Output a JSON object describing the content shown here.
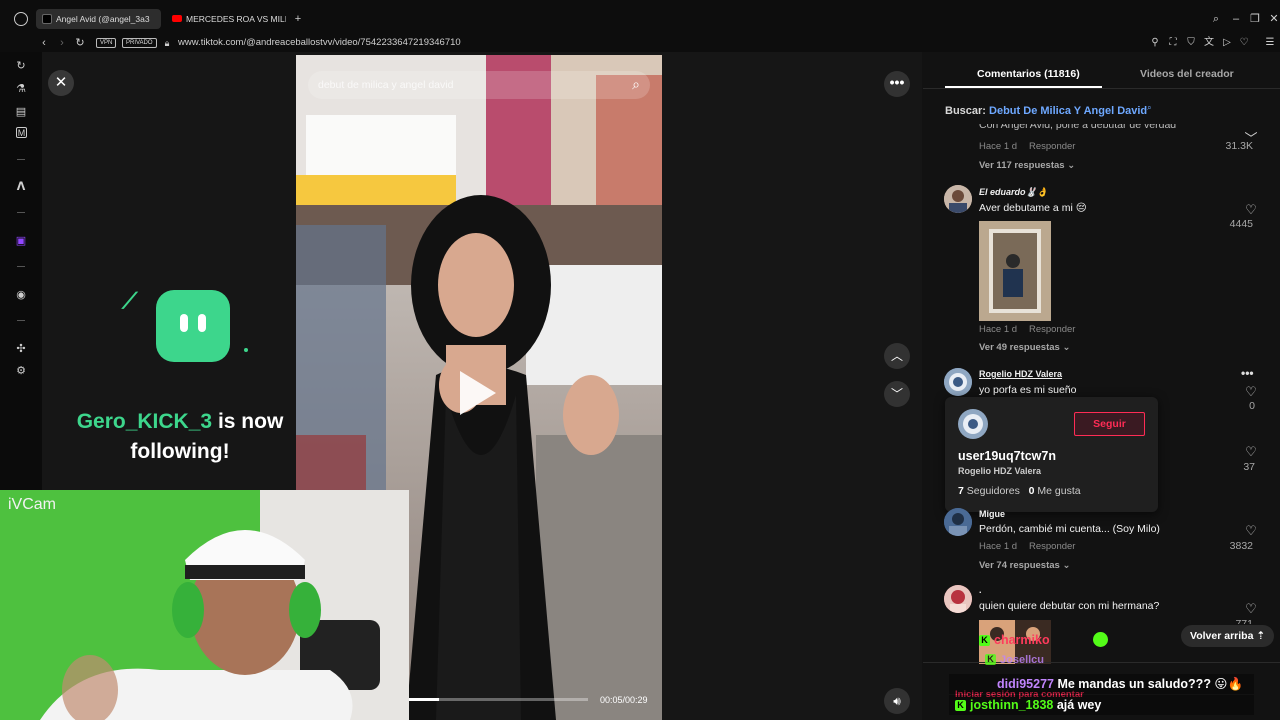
{
  "browser": {
    "tabs": [
      {
        "label": "Angel Avid (@angel_3a3",
        "active": true
      },
      {
        "label": "MERCEDES ROA VS MILIC",
        "active": false
      }
    ],
    "vpn_label": "VPN",
    "private_label": "PRIVADO",
    "url": "www.tiktok.com/@andreaceballostvv/video/7542233647219346710"
  },
  "player": {
    "search_placeholder": "debut de milica y angel david",
    "time": "00:05/00:29",
    "progress": 0.17
  },
  "overlay": {
    "follower_name": "Gero_KICK_3",
    "follow_text_1": "is now",
    "follow_text_2": "following!",
    "cam_label": "iVCam"
  },
  "comments": {
    "tab_comments": "Comentarios (11816)",
    "tab_videos": "Videos del creador",
    "search_label": "Buscar:",
    "search_query": "Debut De Milica Y Angel David",
    "items": [
      {
        "text": "Con Angel Avid, pone a debutar de verdad",
        "time": "Hace 1 d",
        "reply": "Responder",
        "more": "Ver 117 respuestas",
        "likes": "31.3K"
      },
      {
        "user": "El eduardo🐰👌",
        "text": "Aver debutame a mi 😔",
        "time": "Hace 1 d",
        "reply": "Responder",
        "more": "Ver 49 respuestas",
        "likes": "4445"
      },
      {
        "user": "Rogelio HDZ Valera",
        "text": "yo porfa es mi sueño",
        "likes": "0"
      },
      {
        "likes": "37"
      },
      {
        "user": "Migue",
        "text": "Perdón, cambié mi cuenta... (Soy Milo)",
        "time": "Hace 1 d",
        "reply": "Responder",
        "more": "Ver 74 respuestas",
        "likes": "3832"
      },
      {
        "user": ".",
        "text": "quien quiere debutar con mi hermana?",
        "likes": "771"
      }
    ],
    "scroll_top": "Volver arriba",
    "login_prompt": "Iniciar sesión para comentar"
  },
  "profile_card": {
    "handle": "user19uq7tcw7n",
    "name": "Rogelio HDZ Valera",
    "followers": "7",
    "followers_label": "Seguidores",
    "likes": "0",
    "likes_label": "Me gusta",
    "follow_button": "Seguir"
  },
  "chat": [
    {
      "user": "charmiko",
      "text": "",
      "color": "#ff3b5c"
    },
    {
      "user": "Josellcu",
      "text": "",
      "color": "#c084fc"
    },
    {
      "user": "didi95277",
      "text": "Me mandas un saludo??? 😛🔥",
      "color": "#c084fc"
    },
    {
      "user": "josthinn_1838",
      "text": "ajá wey",
      "color": "#53fc18"
    }
  ],
  "colors": {
    "kick_green": "#53fc18",
    "tiktok_red": "#fe2c55",
    "link_blue": "#6ea8ff"
  }
}
